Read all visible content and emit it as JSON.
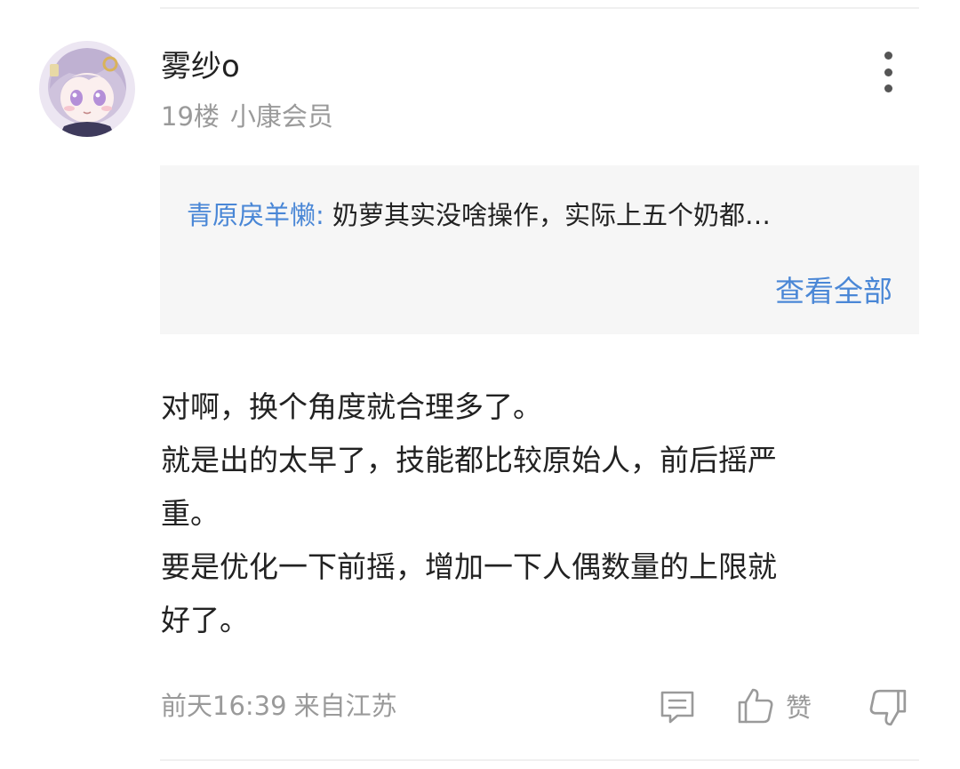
{
  "comment": {
    "author": "雾纱o",
    "floor": "19楼",
    "badge": "小康会员",
    "quote": {
      "author": "青原戾羊懒:",
      "text": "奶萝其实没啥操作，实际上五个奶都…",
      "view_all_label": "查看全部"
    },
    "body_lines": [
      "对啊，换个角度就合理多了。",
      "就是出的太早了，技能都比较原始人，前后摇严",
      "重。",
      "要是优化一下前摇，增加一下人偶数量的上限就",
      "好了。"
    ],
    "time": "前天16:39",
    "location": "来自江苏",
    "like_label": "赞"
  },
  "icons": {
    "more": "more-vertical-icon",
    "reply": "comment-icon",
    "like": "thumbs-up-icon",
    "dislike": "thumbs-down-icon"
  },
  "colors": {
    "link": "#4a87d6",
    "meta": "#9a9a9a",
    "quote_bg": "#f6f6f6"
  }
}
